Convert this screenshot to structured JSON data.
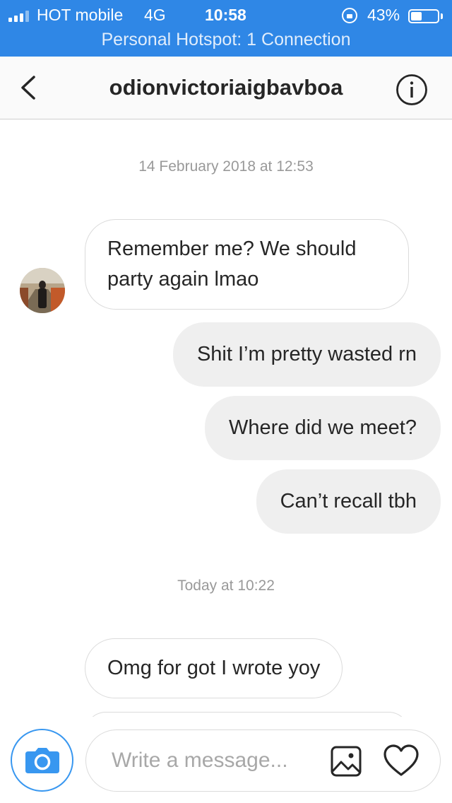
{
  "status_bar": {
    "carrier": "HOT mobile",
    "network": "4G",
    "time": "10:58",
    "battery_percent_label": "43%",
    "battery_level": 0.43,
    "hotspot": "Personal Hotspot: 1 Connection"
  },
  "header": {
    "title": "odionvictoriaigbavboa",
    "back_icon": "chevron-left-icon",
    "info_icon": "info-icon"
  },
  "conversation": {
    "timestamp_1": "14 February 2018 at 12:53",
    "messages_1": [
      {
        "direction": "incoming",
        "text": "Remember me? We should party again lmao"
      },
      {
        "direction": "outgoing",
        "text": "Shit I’m pretty wasted rn"
      },
      {
        "direction": "outgoing",
        "text": "Where did we meet?"
      },
      {
        "direction": "outgoing",
        "text": "Can’t recall tbh"
      }
    ],
    "timestamp_2": "Today at 10:22",
    "messages_2": [
      {
        "direction": "incoming",
        "text": "Omg for got I wrote yoy"
      }
    ]
  },
  "composer": {
    "placeholder": "Write a message...",
    "camera_icon": "camera-icon",
    "gallery_icon": "gallery-icon",
    "like_icon": "heart-icon"
  },
  "colors": {
    "status_bar": "#2f87e6",
    "accent": "#3897f0",
    "outgoing_bubble": "#efefef",
    "incoming_border": "#dbdbdb"
  }
}
